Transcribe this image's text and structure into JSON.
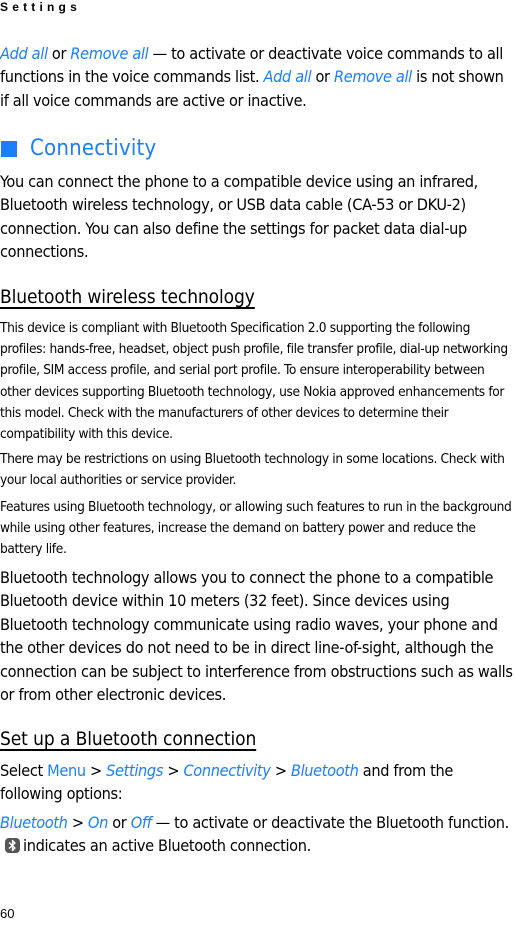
{
  "running_head": "Settings",
  "accent_color": "#1a7fff",
  "voice_para": {
    "link1": "Add all",
    "or1": " or ",
    "link2": "Remove all",
    "text1": " — to activate or deactivate voice commands to all functions in the voice commands list. ",
    "link3": "Add all",
    "or2": " or ",
    "link4": "Remove all",
    "text2": " is not shown if all voice commands are active or inactive."
  },
  "connectivity": {
    "icon": "square-icon",
    "title": "Connectivity",
    "intro": "You can connect the phone to a compatible device using an infrared, Bluetooth wireless technology, or USB data cable (CA-53 or DKU-2) connection. You can also define the settings for  packet data dial-up connections."
  },
  "bluetooth": {
    "title": "Bluetooth wireless technology",
    "para1": "This device is compliant with Bluetooth Specification 2.0 supporting the following profiles: hands-free, headset, object push profile, file transfer profile, dial-up networking profile, SIM access profile, and serial port profile. To ensure interoperability between other devices supporting Bluetooth technology, use Nokia approved enhancements for this model. Check with the manufacturers of other devices to determine their compatibility with this device.",
    "para2": "There may be restrictions on using Bluetooth technology in some locations. Check with your local authorities or service provider.",
    "para3": "Features using Bluetooth technology, or allowing such features to run in the background while using other features, increase the demand on battery power and reduce the battery life.",
    "para4": "Bluetooth technology allows you to connect the phone to a compatible Bluetooth device within 10 meters (32 feet). Since devices using Bluetooth technology communicate using radio waves, your phone and the other devices do not need to be in direct line-of-sight, although the connection can be subject to interference from obstructions such as walls or from other electronic devices."
  },
  "setup": {
    "title": "Set up a Bluetooth connection",
    "select": "Select ",
    "menu": "Menu",
    "sep": " > ",
    "path1": "Settings",
    "path2": "Connectivity",
    "path3": "Bluetooth",
    "path_tail": " and from the following options:",
    "opt_bt": "Bluetooth",
    "opt_on": "On",
    "opt_or": " or ",
    "opt_off": "Off",
    "opt_text1": " — to activate or deactivate the Bluetooth function. ",
    "opt_icon": "bluetooth-icon",
    "opt_text2": "indicates an active Bluetooth connection."
  },
  "page_number": "60"
}
